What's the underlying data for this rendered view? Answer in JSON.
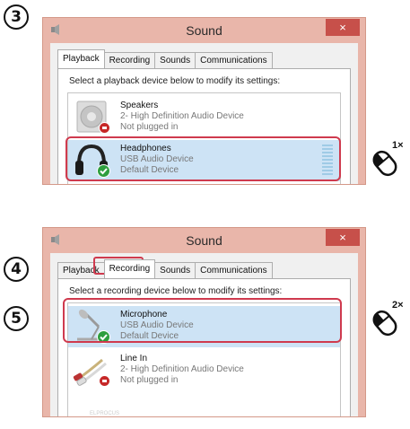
{
  "steps": {
    "s3": "3",
    "s4": "4",
    "s5": "5"
  },
  "window1": {
    "title": "Sound",
    "close_label": "×",
    "tabs": [
      {
        "label": "Playback",
        "active": true
      },
      {
        "label": "Recording",
        "active": false
      },
      {
        "label": "Sounds",
        "active": false
      },
      {
        "label": "Communications",
        "active": false
      }
    ],
    "instruction": "Select a playback device below to modify its settings:",
    "devices": [
      {
        "name": "Speakers",
        "line1": "2- High Definition Audio Device",
        "line2": "Not plugged in",
        "icon": "speaker-icon",
        "status": "unplugged"
      },
      {
        "name": "Headphones",
        "line1": "USB Audio Device",
        "line2": "Default Device",
        "icon": "headphones-icon",
        "status": "default",
        "selected": true
      }
    ]
  },
  "window2": {
    "title": "Sound",
    "close_label": "×",
    "tabs": [
      {
        "label": "Playback",
        "active": false
      },
      {
        "label": "Recording",
        "active": true
      },
      {
        "label": "Sounds",
        "active": false
      },
      {
        "label": "Communications",
        "active": false
      }
    ],
    "instruction": "Select a recording device below to modify its settings:",
    "devices": [
      {
        "name": "Microphone",
        "line1": "USB Audio Device",
        "line2": "Default Device",
        "icon": "microphone-icon",
        "status": "default",
        "selected": true
      },
      {
        "name": "Line In",
        "line1": "2- High Definition Audio Device",
        "line2": "Not plugged in",
        "icon": "line-in-icon",
        "status": "unplugged"
      }
    ]
  },
  "annotations": {
    "click1": "1×",
    "click2": "2×"
  },
  "colors": {
    "frame": "#e9b6aa",
    "close": "#c7504a",
    "selection": "#cde3f5",
    "highlight": "#cf3a4e",
    "check": "#2e9e3e",
    "unplugged": "#c62828"
  },
  "watermark": "ELPROCUS"
}
